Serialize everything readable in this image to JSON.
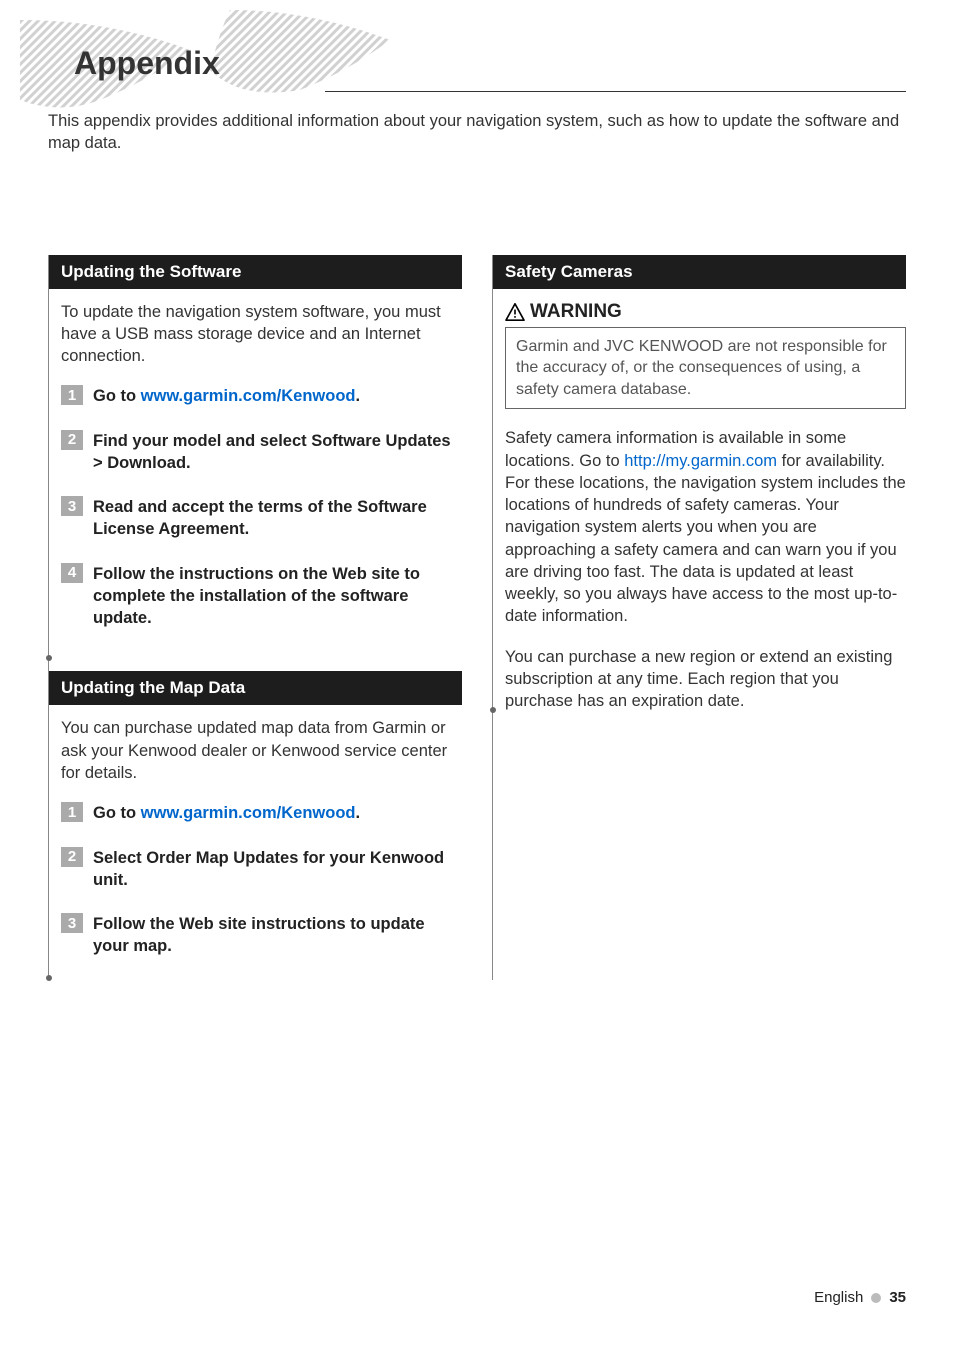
{
  "title": "Appendix",
  "intro": "This appendix provides additional information about your navigation system, such as how to update the software and map data.",
  "left": {
    "section1": {
      "header": "Updating the Software",
      "body": "To update the navigation system software, you must have a USB mass storage device and an Internet connection.",
      "steps": [
        {
          "num": "1",
          "pre": "Go to ",
          "link": "www.garmin.com/Kenwood",
          "post": "."
        },
        {
          "num": "2",
          "text": "Find your model and select Software Updates > Download."
        },
        {
          "num": "3",
          "text": "Read and accept the terms of the Software License Agreement."
        },
        {
          "num": "4",
          "text": "Follow the instructions on the Web site to complete the installation of the software update."
        }
      ]
    },
    "section2": {
      "header": "Updating the Map Data",
      "body": "You can purchase updated map data from Garmin or ask your Kenwood dealer or Kenwood service center for details.",
      "steps": [
        {
          "num": "1",
          "pre": "Go to ",
          "link": "www.garmin.com/Kenwood",
          "post": "."
        },
        {
          "num": "2",
          "text": "Select Order Map Updates for your Kenwood unit."
        },
        {
          "num": "3",
          "text": "Follow the Web site instructions to update your map."
        }
      ]
    }
  },
  "right": {
    "section1": {
      "header": "Safety Cameras",
      "warning_label": "WARNING",
      "warning_body": "Garmin and JVC KENWOOD are not responsible for the accuracy of, or the consequences of using, a safety camera database.",
      "para1_pre": "Safety camera information is available in some locations. Go to ",
      "para1_link": "http://my.garmin.com",
      "para1_post": " for availability. For these locations, the navigation system includes the locations of hundreds of safety cameras. Your navigation system alerts you when you are approaching a safety camera and can warn you if you are driving too fast. The data is updated at least weekly, so you always have access to the most up-to-date information.",
      "para2": "You can purchase a new region or extend an existing subscription at any time. Each region that you purchase has an expiration date."
    }
  },
  "footer": {
    "lang": "English",
    "page": "35"
  }
}
